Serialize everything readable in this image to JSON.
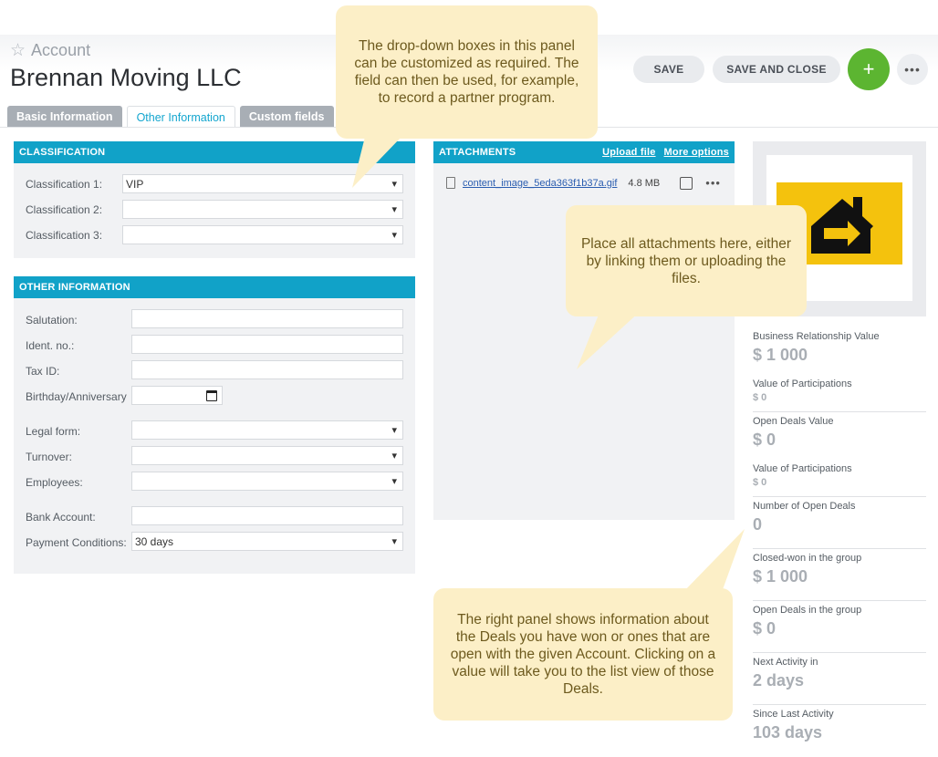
{
  "header": {
    "crumb": "Account",
    "title": "Brennan Moving LLC",
    "save_label": "SAVE",
    "save_close_label": "SAVE AND CLOSE",
    "add_label": "+",
    "more_label": "•••"
  },
  "tabs": [
    {
      "label": "Basic Information",
      "active": false
    },
    {
      "label": "Other Information",
      "active": true
    },
    {
      "label": "Custom fields",
      "active": false
    }
  ],
  "classification": {
    "title": "CLASSIFICATION",
    "fields": [
      {
        "label": "Classification 1:",
        "value": "VIP"
      },
      {
        "label": "Classification 2:",
        "value": ""
      },
      {
        "label": "Classification 3:",
        "value": ""
      }
    ]
  },
  "other_info": {
    "title": "OTHER INFORMATION",
    "fields": [
      {
        "label": "Salutation:",
        "value": ""
      },
      {
        "label": "Ident. no.:",
        "value": ""
      },
      {
        "label": "Tax ID:",
        "value": ""
      },
      {
        "label": "Birthday/Anniversary",
        "value": ""
      },
      {
        "label": "Legal form:",
        "value": ""
      },
      {
        "label": "Turnover:",
        "value": ""
      },
      {
        "label": "Employees:",
        "value": ""
      },
      {
        "label": "Bank Account:",
        "value": ""
      },
      {
        "label": "Payment Conditions:",
        "value": "30 days"
      }
    ]
  },
  "attachments": {
    "title": "ATTACHMENTS",
    "upload_label": "Upload file",
    "more_options_label": "More options",
    "file": {
      "name": "content_image_5eda363f1b37a.gif",
      "size": "4.8 MB"
    }
  },
  "stats": [
    {
      "label": "Business Relationship Value",
      "value": "$ 1 000"
    },
    {
      "label": "Value of Participations",
      "value": "$ 0"
    },
    {
      "label": "Open Deals Value",
      "value": "$ 0"
    },
    {
      "label": "Value of Participations",
      "value": "$ 0"
    },
    {
      "label": "Number of Open Deals",
      "value": "0"
    },
    {
      "label": "Closed-won in the group",
      "value": "$ 1 000"
    },
    {
      "label": "Open Deals in the group",
      "value": "$ 0"
    },
    {
      "label": "Next Activity in",
      "value": "2 days"
    },
    {
      "label": "Since Last Activity",
      "value": "103 days"
    }
  ],
  "callouts": {
    "dropdown": "The drop-down boxes in this panel can be customized as required. The field can then be used, for example, to record a partner program.",
    "attachments": "Place all attachments here, either by linking them or uploading the files.",
    "right_panel": "The right panel shows information about the Deals you have won or ones that are open with the given Account. Clicking on a value will take you to the list view of those Deals."
  },
  "colors": {
    "accent": "#11a2c8",
    "add_button": "#5cb531",
    "callout_bg": "#fcefc7",
    "logo_yellow": "#f4c20d"
  }
}
